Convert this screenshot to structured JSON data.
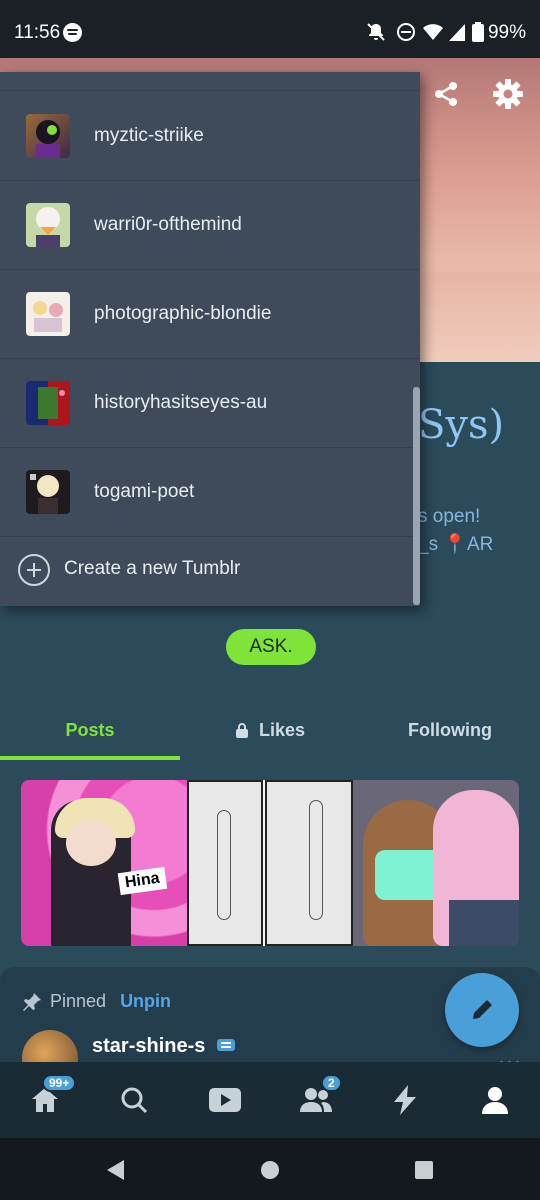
{
  "status_bar": {
    "time": "11:56",
    "battery": "99%",
    "icons": [
      "spotify-icon",
      "notifications-off-icon",
      "do-not-disturb-icon",
      "wifi-icon",
      "cell-signal-icon",
      "battery-icon"
    ]
  },
  "header": {
    "share_icon": "share-icon",
    "settings_icon": "gear-icon"
  },
  "blog": {
    "title_fragment": "Sys)",
    "description_line1": "s open!",
    "description_line2": "_s 📍AR",
    "ask_label": "ASK."
  },
  "blog_menu": {
    "items": [
      {
        "name": "myztic-striike"
      },
      {
        "name": "warri0r-ofthemind"
      },
      {
        "name": "photographic-blondie"
      },
      {
        "name": "historyhasitseyes-au"
      },
      {
        "name": "togami-poet"
      }
    ],
    "create_label": "Create a new Tumblr"
  },
  "tabs": {
    "posts": "Posts",
    "likes": "Likes",
    "following": "Following",
    "active": "posts"
  },
  "grid": {
    "thumb1_text": "Hina"
  },
  "post": {
    "pinned_label": "Pinned",
    "unpin_label": "Unpin",
    "username": "star-shine-s",
    "more": "•••"
  },
  "bottom_nav": {
    "home_badge": "99+",
    "activity_badge": "2",
    "items": [
      "home-icon",
      "search-icon",
      "video-icon",
      "people-icon",
      "lightning-icon",
      "profile-icon"
    ]
  },
  "colors": {
    "accent_green": "#7fe33a",
    "accent_blue": "#4a9fd9",
    "background": "#2b4a5a",
    "menu_bg": "#3f4b5b"
  }
}
